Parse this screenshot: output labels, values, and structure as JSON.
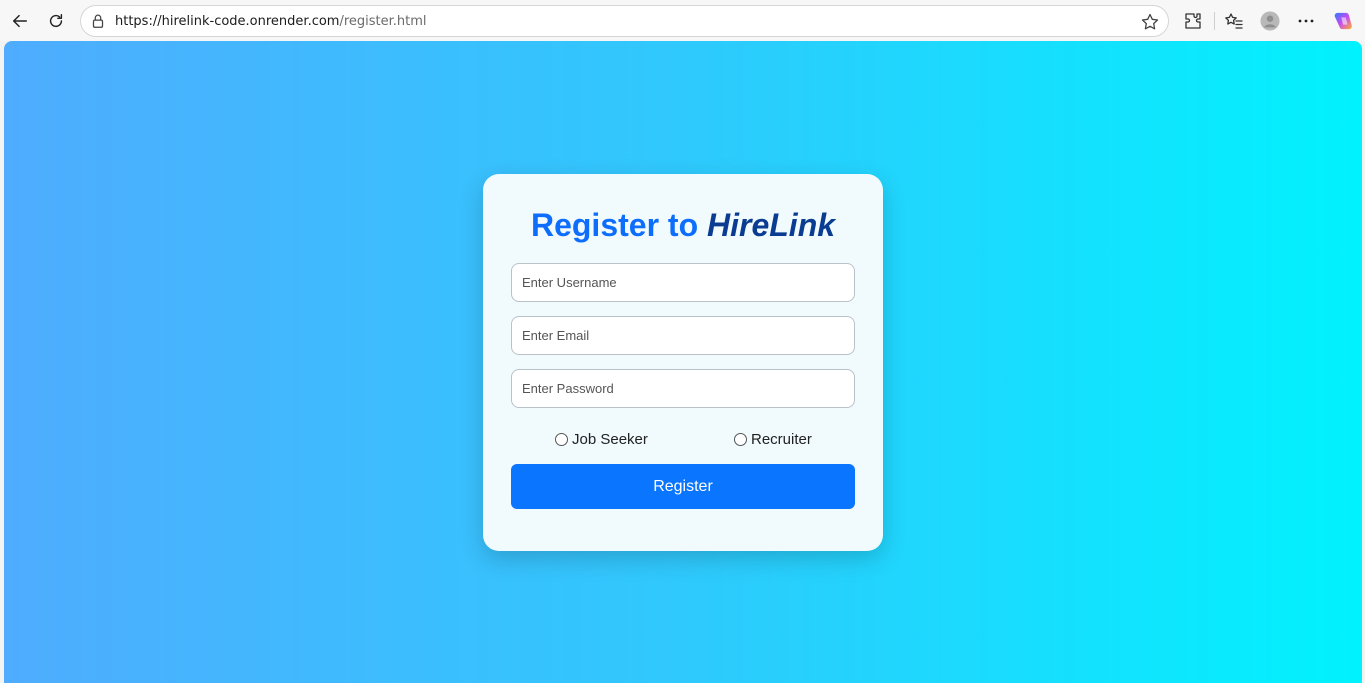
{
  "browser": {
    "url_host": "https://hirelink-code.onrender.com",
    "url_path": "/register.html"
  },
  "form": {
    "title_prefix": "Register to",
    "title_brand": "HireLink",
    "username_placeholder": "Enter Username",
    "email_placeholder": "Enter Email",
    "password_placeholder": "Enter Password",
    "role_options": [
      "Job Seeker",
      "Recruiter"
    ],
    "submit_label": "Register"
  },
  "colors": {
    "gradient_start": "#4facfe",
    "gradient_end": "#00f2fe",
    "title_accent": "#0d6efd",
    "brand": "#0a3d91",
    "button": "#0a75ff"
  },
  "icons": [
    "back-arrow-icon",
    "refresh-icon",
    "lock-icon",
    "favorite-star-icon",
    "extensions-icon",
    "favorites-icon",
    "profile-icon",
    "more-icon",
    "copilot-icon"
  ]
}
